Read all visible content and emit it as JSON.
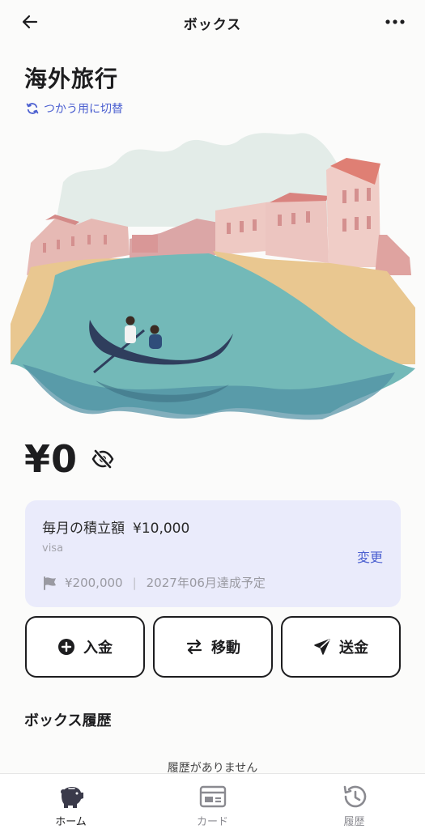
{
  "header": {
    "title": "ボックス"
  },
  "box": {
    "name": "海外旅行",
    "switch_label": "つかう用に切替"
  },
  "balance": {
    "amount": "¥0"
  },
  "savings": {
    "monthly_label": "毎月の積立額",
    "monthly_amount": "¥10,000",
    "account": "visa",
    "change_label": "変更",
    "goal_amount": "¥200,000",
    "goal_date": "2027年06月達成予定"
  },
  "actions": {
    "deposit": "入金",
    "transfer": "移動",
    "send": "送金"
  },
  "history": {
    "title": "ボックス履歴",
    "empty": "履歴がありません"
  },
  "nav": {
    "home": "ホーム",
    "card": "カード",
    "history": "履歴"
  },
  "colors": {
    "accent": "#4b5fd0",
    "card_bg": "#eaebfb",
    "text": "#1d1d1f"
  }
}
